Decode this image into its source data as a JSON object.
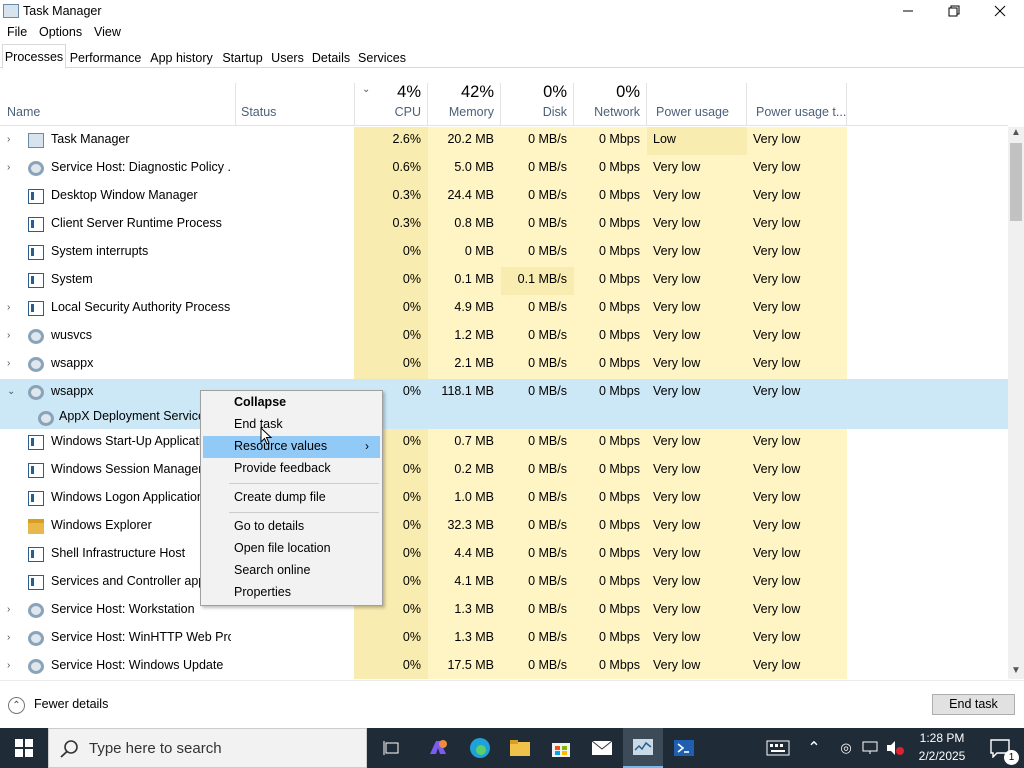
{
  "window": {
    "title": "Task Manager"
  },
  "menu": [
    "File",
    "Options",
    "View"
  ],
  "tabs": [
    "Processes",
    "Performance",
    "App history",
    "Startup",
    "Users",
    "Details",
    "Services"
  ],
  "columns": {
    "name": "Name",
    "status": "Status",
    "cpu_pct": "4%",
    "cpu": "CPU",
    "memory_pct": "42%",
    "memory": "Memory",
    "disk_pct": "0%",
    "disk": "Disk",
    "network_pct": "0%",
    "network": "Network",
    "power": "Power usage",
    "power_trend": "Power usage t..."
  },
  "processes": [
    {
      "name": "Task Manager",
      "cpu": "2.6%",
      "mem": "20.2 MB",
      "disk": "0 MB/s",
      "net": "0 Mbps",
      "power": "Low",
      "trend": "Very low",
      "icon": "task-manager-icon",
      "expand": ">"
    },
    {
      "name": "Service Host: Diagnostic Policy ...",
      "cpu": "0.6%",
      "mem": "5.0 MB",
      "disk": "0 MB/s",
      "net": "0 Mbps",
      "power": "Very low",
      "trend": "Very low",
      "icon": "gear-icon",
      "expand": ">"
    },
    {
      "name": "Desktop Window Manager",
      "cpu": "0.3%",
      "mem": "24.4 MB",
      "disk": "0 MB/s",
      "net": "0 Mbps",
      "power": "Very low",
      "trend": "Very low",
      "icon": "window-icon",
      "expand": ""
    },
    {
      "name": "Client Server Runtime Process",
      "cpu": "0.3%",
      "mem": "0.8 MB",
      "disk": "0 MB/s",
      "net": "0 Mbps",
      "power": "Very low",
      "trend": "Very low",
      "icon": "window-icon",
      "expand": ""
    },
    {
      "name": "System interrupts",
      "cpu": "0%",
      "mem": "0 MB",
      "disk": "0 MB/s",
      "net": "0 Mbps",
      "power": "Very low",
      "trend": "Very low",
      "icon": "window-icon",
      "expand": ""
    },
    {
      "name": "System",
      "cpu": "0%",
      "mem": "0.1 MB",
      "disk": "0.1 MB/s",
      "net": "0 Mbps",
      "power": "Very low",
      "trend": "Very low",
      "icon": "window-icon",
      "expand": ""
    },
    {
      "name": "Local Security Authority Process...",
      "cpu": "0%",
      "mem": "4.9 MB",
      "disk": "0 MB/s",
      "net": "0 Mbps",
      "power": "Very low",
      "trend": "Very low",
      "icon": "window-icon",
      "expand": ">"
    },
    {
      "name": "wusvcs",
      "cpu": "0%",
      "mem": "1.2 MB",
      "disk": "0 MB/s",
      "net": "0 Mbps",
      "power": "Very low",
      "trend": "Very low",
      "icon": "gear-icon",
      "expand": ">"
    },
    {
      "name": "wsappx",
      "cpu": "0%",
      "mem": "2.1 MB",
      "disk": "0 MB/s",
      "net": "0 Mbps",
      "power": "Very low",
      "trend": "Very low",
      "icon": "gear-icon",
      "expand": ">"
    },
    {
      "name": "wsappx",
      "cpu": "0%",
      "mem": "118.1 MB",
      "disk": "0 MB/s",
      "net": "0 Mbps",
      "power": "Very low",
      "trend": "Very low",
      "icon": "gear-icon",
      "expand": "v",
      "selected": true
    },
    {
      "name": "AppX Deployment Service",
      "cpu": "",
      "mem": "",
      "disk": "",
      "net": "",
      "power": "",
      "trend": "",
      "icon": "gear-icon",
      "expand": "",
      "child": true
    },
    {
      "name": "Windows Start-Up Application",
      "cpu": "0%",
      "mem": "0.7 MB",
      "disk": "0 MB/s",
      "net": "0 Mbps",
      "power": "Very low",
      "trend": "Very low",
      "icon": "window-icon",
      "expand": ""
    },
    {
      "name": "Windows Session Manager",
      "cpu": "0%",
      "mem": "0.2 MB",
      "disk": "0 MB/s",
      "net": "0 Mbps",
      "power": "Very low",
      "trend": "Very low",
      "icon": "window-icon",
      "expand": ""
    },
    {
      "name": "Windows Logon Application",
      "cpu": "0%",
      "mem": "1.0 MB",
      "disk": "0 MB/s",
      "net": "0 Mbps",
      "power": "Very low",
      "trend": "Very low",
      "icon": "window-icon",
      "expand": ""
    },
    {
      "name": "Windows Explorer",
      "cpu": "0%",
      "mem": "32.3 MB",
      "disk": "0 MB/s",
      "net": "0 Mbps",
      "power": "Very low",
      "trend": "Very low",
      "icon": "folder-icon",
      "expand": ""
    },
    {
      "name": "Shell Infrastructure Host",
      "cpu": "0%",
      "mem": "4.4 MB",
      "disk": "0 MB/s",
      "net": "0 Mbps",
      "power": "Very low",
      "trend": "Very low",
      "icon": "window-icon",
      "expand": ""
    },
    {
      "name": "Services and Controller app",
      "cpu": "0%",
      "mem": "4.1 MB",
      "disk": "0 MB/s",
      "net": "0 Mbps",
      "power": "Very low",
      "trend": "Very low",
      "icon": "window-icon",
      "expand": ""
    },
    {
      "name": "Service Host: Workstation",
      "cpu": "0%",
      "mem": "1.3 MB",
      "disk": "0 MB/s",
      "net": "0 Mbps",
      "power": "Very low",
      "trend": "Very low",
      "icon": "gear-icon",
      "expand": ">"
    },
    {
      "name": "Service Host: WinHTTP Web Pro...",
      "cpu": "0%",
      "mem": "1.3 MB",
      "disk": "0 MB/s",
      "net": "0 Mbps",
      "power": "Very low",
      "trend": "Very low",
      "icon": "gear-icon",
      "expand": ">"
    },
    {
      "name": "Service Host: Windows Update",
      "cpu": "0%",
      "mem": "17.5 MB",
      "disk": "0 MB/s",
      "net": "0 Mbps",
      "power": "Very low",
      "trend": "Very low",
      "icon": "gear-icon",
      "expand": ">"
    }
  ],
  "context_menu": {
    "collapse": "Collapse",
    "end_task": "End task",
    "resource_values": "Resource values",
    "provide_feedback": "Provide feedback",
    "create_dump": "Create dump file",
    "go_to_details": "Go to details",
    "open_file_location": "Open file location",
    "search_online": "Search online",
    "properties": "Properties"
  },
  "footer": {
    "fewer_details": "Fewer details",
    "end_task": "End task"
  },
  "taskbar": {
    "search_placeholder": "Type here to search",
    "time": "1:28 PM",
    "date": "2/2/2025",
    "notifications": "1"
  }
}
